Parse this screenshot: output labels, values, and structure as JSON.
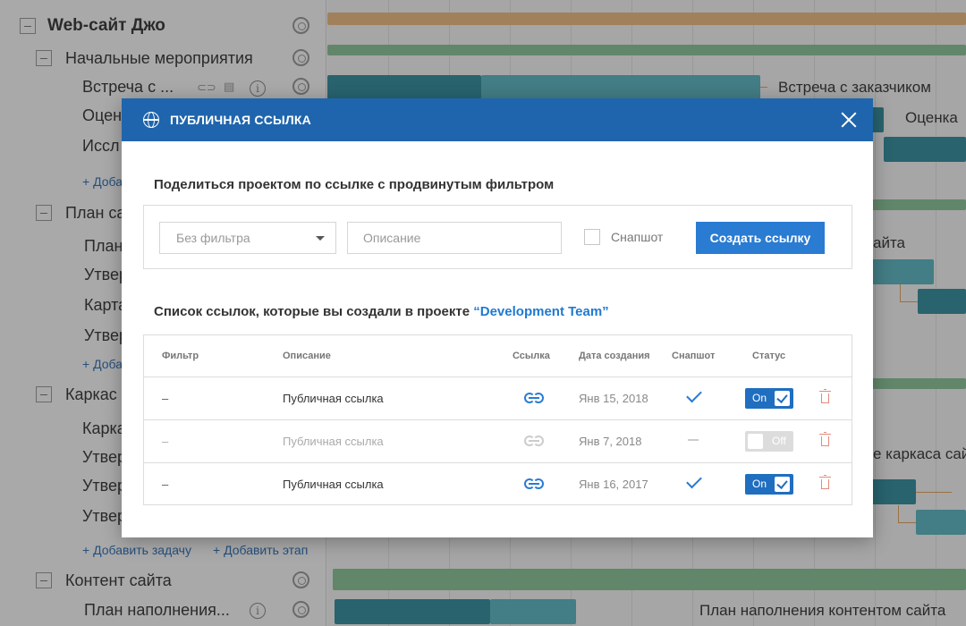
{
  "tree": {
    "project": "Web-сайт Джо",
    "groups": [
      {
        "label": "Начальные мероприятия"
      },
      {
        "label": "План са"
      },
      {
        "label": "Каркас"
      },
      {
        "label": "Контент сайта"
      }
    ],
    "tasks": [
      {
        "label": "Встреча с ..."
      },
      {
        "label": "Оцен"
      },
      {
        "label": "Иссл"
      },
      {
        "label": "План"
      },
      {
        "label": "Утвер"
      },
      {
        "label": "Карта"
      },
      {
        "label": "Утвер"
      },
      {
        "label": "Карка"
      },
      {
        "label": "Утвер"
      },
      {
        "label": "Утвер"
      },
      {
        "label": "Утвер"
      },
      {
        "label": "План наполнения..."
      }
    ],
    "add_task": "+ Добавить задачу",
    "add_task_cut": "+ Доба",
    "add_stage": "+ Добавить этап"
  },
  "gantt": {
    "labels": [
      "Встреча с заказчиком",
      "Оценка",
      "айта",
      "е каркаса сайт",
      "План наполнения контентом сайта"
    ],
    "colors": {
      "teal_dark": "#2f8fa0",
      "teal_light": "#5bb8c6",
      "green": "#8cc79a",
      "orange": "#f3bf82"
    }
  },
  "modal": {
    "title": "ПУБЛИЧНАЯ ССЫЛКА",
    "share_heading": "Поделиться проектом по ссылке с продвинутым фильтром",
    "filter_value": "Без фильтра",
    "description_placeholder": "Описание",
    "snapshot_label": "Снапшот",
    "create_button": "Создать ссылку",
    "list_heading": "Список ссылок, которые вы создали в проекте",
    "project_name": "“Development Team”",
    "columns": [
      "Фильтр",
      "Описание",
      "Ссылка",
      "Дата создания",
      "Снапшот",
      "Статус"
    ],
    "rows": [
      {
        "filter": "–",
        "description": "Публичная ссылка",
        "date": "Янв 15, 2018",
        "snapshot": true,
        "status": "On"
      },
      {
        "filter": "–",
        "description": "Публичная ссылка",
        "date": "Янв 7, 2018",
        "snapshot": false,
        "status": "Off"
      },
      {
        "filter": "–",
        "description": "Публичная ссылка",
        "date": "Янв 16, 2017",
        "snapshot": true,
        "status": "On"
      }
    ],
    "accent_color": "#1f65ad"
  }
}
